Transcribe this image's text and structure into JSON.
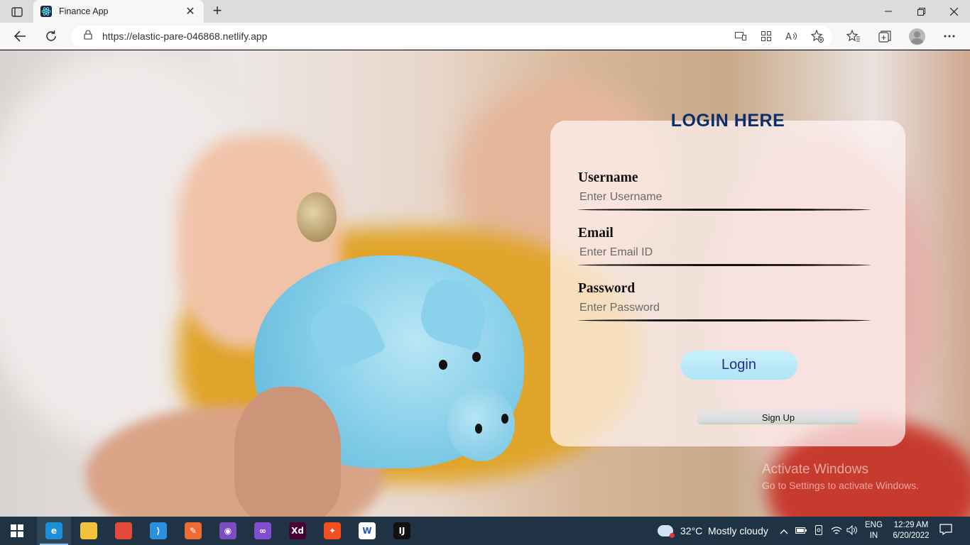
{
  "browser": {
    "tab_title": "Finance App",
    "tab_close": "✕",
    "new_tab": "+",
    "url": "https://elastic-pare-046868.netlify.app"
  },
  "login": {
    "title": "LOGIN HERE",
    "username_label": "Username",
    "username_placeholder": "Enter Username",
    "email_label": "Email",
    "email_placeholder": "Enter Email ID",
    "password_label": "Password",
    "password_placeholder": "Enter Password",
    "login_button": "Login",
    "signup_button": "Sign Up"
  },
  "watermark": {
    "line1": "Activate Windows",
    "line2": "Go to Settings to activate Windows."
  },
  "taskbar": {
    "apps": [
      {
        "icon": "edge-icon",
        "glyph": "e",
        "color": "#1b8fd8"
      },
      {
        "icon": "file-explorer-icon",
        "glyph": "",
        "color": "#f3c23c"
      },
      {
        "icon": "chrome-icon",
        "glyph": "",
        "color": "#e24a3b"
      },
      {
        "icon": "vscode-icon",
        "glyph": "⟩",
        "color": "#2b8fe0"
      },
      {
        "icon": "postman-icon",
        "glyph": "✎",
        "color": "#ef6b35"
      },
      {
        "icon": "github-desktop-icon",
        "glyph": "◉",
        "color": "#7a4ec2"
      },
      {
        "icon": "visual-studio-icon",
        "glyph": "∞",
        "color": "#7f4fd0"
      },
      {
        "icon": "adobe-xd-icon",
        "glyph": "Xd",
        "color": "#470137"
      },
      {
        "icon": "figma-icon",
        "glyph": "✦",
        "color": "#f24e1e"
      },
      {
        "icon": "app-w-icon",
        "glyph": "W",
        "color": "#ffffff"
      },
      {
        "icon": "jetbrains-icon",
        "glyph": "IJ",
        "color": "#111111"
      }
    ],
    "weather": "32°C  Mostly cloudy",
    "lang_1": "ENG",
    "lang_2": "IN",
    "time": "12:29 AM",
    "date": "6/20/2022"
  }
}
